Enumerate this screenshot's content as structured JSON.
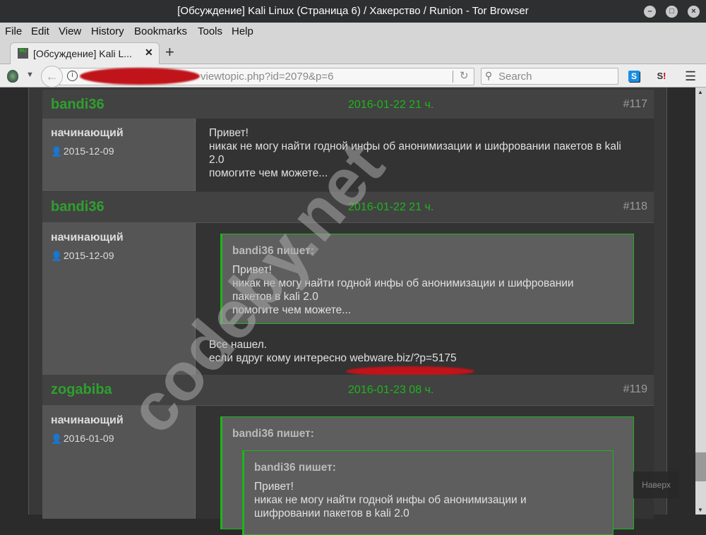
{
  "window": {
    "title": "[Обсуждение] Kali Linux (Страница 6) / Хакерство / Runion - Tor Browser"
  },
  "menu": [
    "File",
    "Edit",
    "View",
    "History",
    "Bookmarks",
    "Tools",
    "Help"
  ],
  "tab": {
    "title": "[Обсуждение] Kali L...",
    "favicon_text": "RU"
  },
  "navbar": {
    "url": "viewtopic.php?id=2079&p=6",
    "search_placeholder": "Search"
  },
  "watermark": "codeby.net",
  "posts": [
    {
      "author": "bandi36",
      "date": "2016-01-22 21 ч.",
      "num": "#117",
      "rank": "начинающий",
      "registered": "2015-12-09",
      "lines": [
        "Привет!",
        "никак не могу найти годной инфы об анонимизации и шифровании пакетов в kali",
        "2.0",
        "помогите чем можете..."
      ]
    },
    {
      "author": "bandi36",
      "date": "2016-01-22 21 ч.",
      "num": "#118",
      "rank": "начинающий",
      "registered": "2015-12-09",
      "quote": {
        "author": "bandi36 пишет:",
        "lines": [
          "Привет!",
          "никак не могу найти годной инфы об анонимизации и шифровании",
          "пакетов в kali 2.0",
          "помогите чем можете..."
        ]
      },
      "lines": [
        "Все нашел.",
        "если вдруг кому интересно webware.biz/?p=5175"
      ]
    },
    {
      "author": "zogabiba",
      "date": "2016-01-23 08 ч.",
      "num": "#119",
      "rank": "начинающий",
      "registered": "2016-01-09",
      "quote": {
        "author": "bandi36 пишет:",
        "inner": {
          "author": "bandi36 пишет:",
          "lines": [
            "Привет!",
            "никак не могу найти годной инфы об анонимизации и",
            "шифровании пакетов в kali 2.0"
          ]
        }
      }
    }
  ],
  "back_to_top": "Наверх",
  "colors": {
    "accent_green": "#1db51d",
    "redaction": "#c0141a"
  }
}
